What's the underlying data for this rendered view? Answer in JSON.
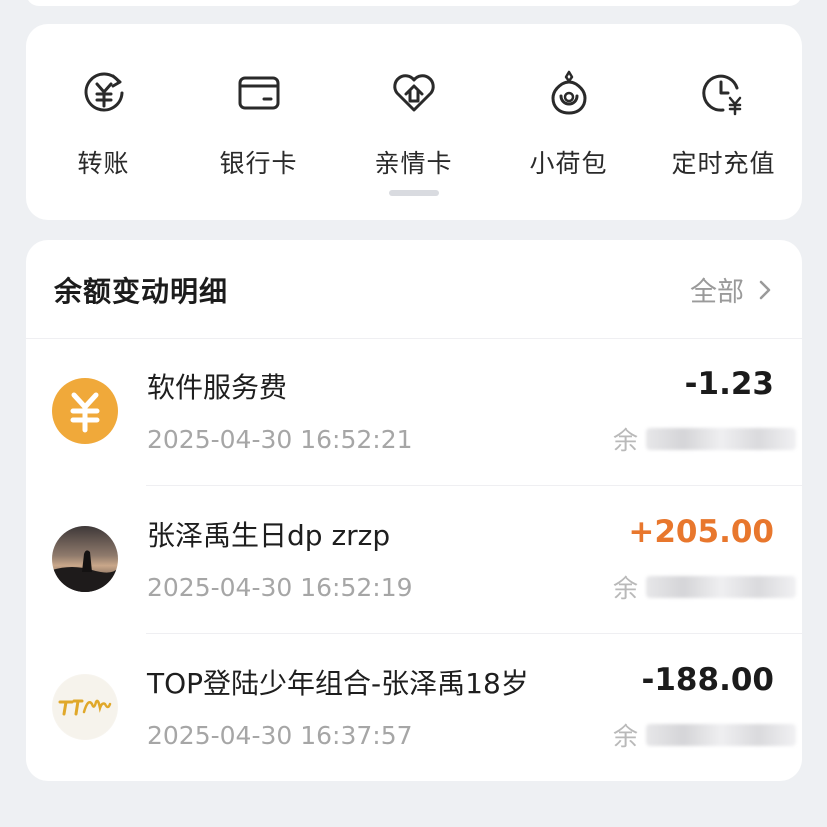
{
  "actions": [
    {
      "label": "转账",
      "icon": "yuan-transfer-icon"
    },
    {
      "label": "银行卡",
      "icon": "bank-card-icon"
    },
    {
      "label": "亲情卡",
      "icon": "family-card-icon"
    },
    {
      "label": "小荷包",
      "icon": "pouch-icon"
    },
    {
      "label": "定时充值",
      "icon": "scheduled-recharge-icon"
    }
  ],
  "balance_section": {
    "title": "余额变动明细",
    "all_label": "全部"
  },
  "transactions": [
    {
      "title": "软件服务费",
      "time": "2025-04-30 16:52:21",
      "amount": "-1.23",
      "balance_prefix": "余",
      "avatar": "yuan-service-avatar"
    },
    {
      "title": "张泽禹生日dp zrzp",
      "time": "2025-04-30 16:52:19",
      "amount": "+205.00",
      "balance_prefix": "余",
      "avatar": "sunset-photo-avatar"
    },
    {
      "title": "TOP登陆少年组合-张泽禹18岁",
      "time": "2025-04-30 16:37:57",
      "amount": "-188.00",
      "balance_prefix": "余",
      "avatar": "tf-family-logo-avatar"
    }
  ],
  "colors": {
    "income": "#e8772d",
    "expense": "#1b1b1b",
    "service_avatar": "#f0a93a"
  }
}
